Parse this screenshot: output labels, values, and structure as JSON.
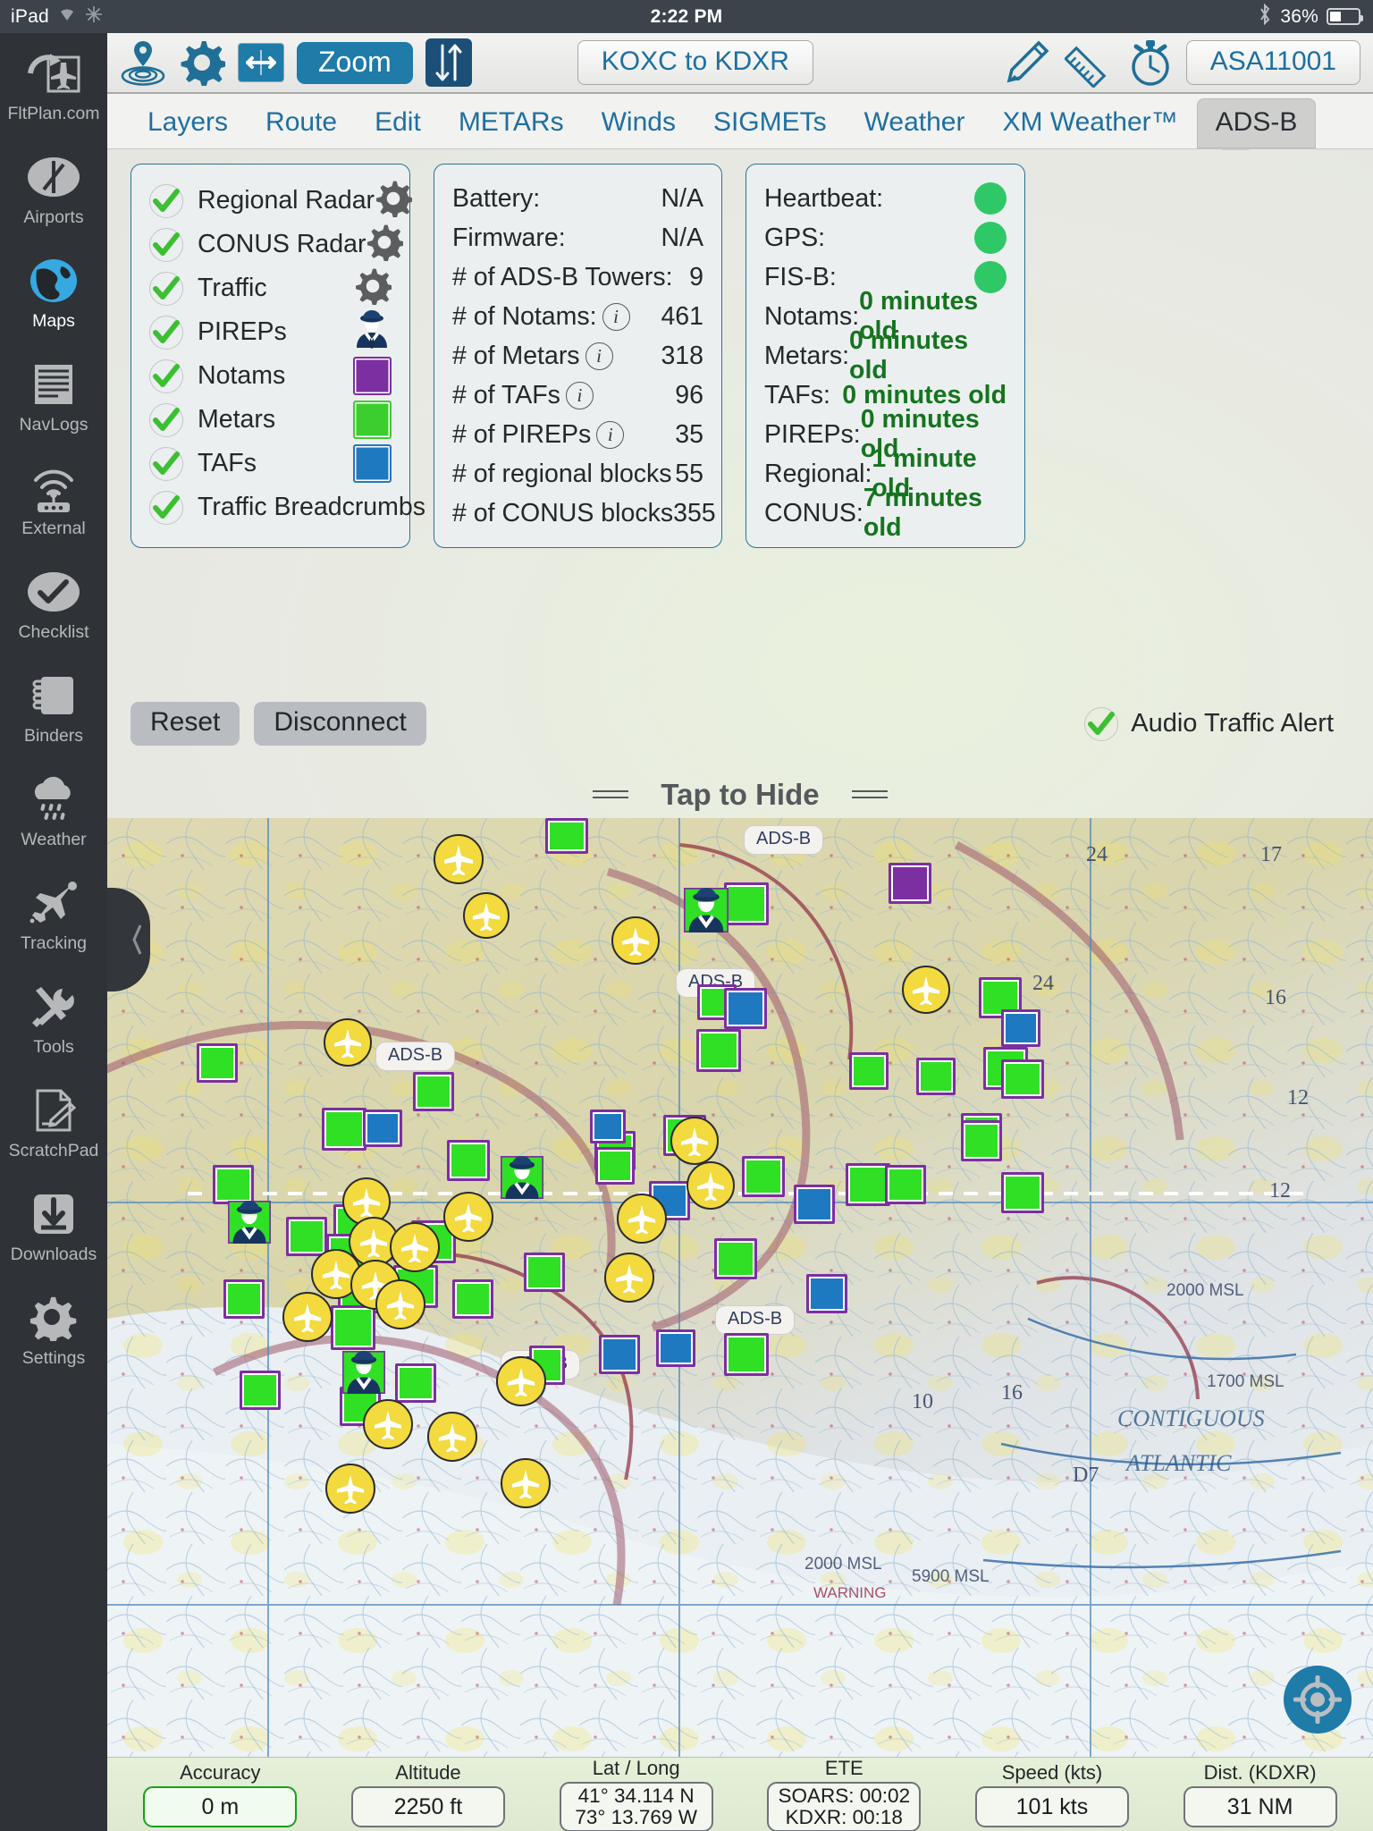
{
  "statusbar": {
    "device": "iPad",
    "wifi_icon": "wifi-icon",
    "sync_icon": "sync-icon",
    "time": "2:22 PM",
    "bluetooth_icon": "bluetooth-icon",
    "battery_pct": "36%"
  },
  "sidebar": {
    "items": [
      {
        "label": "FltPlan.com",
        "icon": "fltplan-logo-icon",
        "active": false
      },
      {
        "label": "Airports",
        "icon": "airports-icon",
        "active": false
      },
      {
        "label": "Maps",
        "icon": "globe-icon",
        "active": true
      },
      {
        "label": "NavLogs",
        "icon": "navlog-icon",
        "active": false
      },
      {
        "label": "External",
        "icon": "antenna-icon",
        "active": false
      },
      {
        "label": "Checklist",
        "icon": "checkmark-icon",
        "active": false
      },
      {
        "label": "Binders",
        "icon": "notebook-icon",
        "active": false
      },
      {
        "label": "Weather",
        "icon": "rain-cloud-icon",
        "active": false
      },
      {
        "label": "Tracking",
        "icon": "airplane-track-icon",
        "active": false
      },
      {
        "label": "Tools",
        "icon": "tools-icon",
        "active": false
      },
      {
        "label": "ScratchPad",
        "icon": "scratchpad-icon",
        "active": false
      },
      {
        "label": "Downloads",
        "icon": "download-icon",
        "active": false
      },
      {
        "label": "Settings",
        "icon": "gear-icon",
        "active": false
      }
    ]
  },
  "toolbar": {
    "icons": [
      {
        "name": "location-pin-icon"
      },
      {
        "name": "gear-icon"
      },
      {
        "name": "split-screen-icon"
      }
    ],
    "zoom_label": "Zoom",
    "updown_icon": "up-down-arrows-icon",
    "route_label": "KOXC to KDXR",
    "pencil_icon": "pencil-icon",
    "ruler_icon": "ruler-icon",
    "stopwatch_icon": "stopwatch-icon",
    "tail_number": "ASA11001"
  },
  "tabs": [
    {
      "label": "Layers",
      "active": false
    },
    {
      "label": "Route",
      "active": false
    },
    {
      "label": "Edit",
      "active": false
    },
    {
      "label": "METARs",
      "active": false
    },
    {
      "label": "Winds",
      "active": false
    },
    {
      "label": "SIGMETs",
      "active": false
    },
    {
      "label": "Weather",
      "active": false
    },
    {
      "label": "XM Weather™",
      "active": false
    },
    {
      "label": "ADS-B",
      "active": true
    }
  ],
  "layers_card": {
    "rows": [
      {
        "label": "Regional Radar",
        "checked": true,
        "control": "gear",
        "color": ""
      },
      {
        "label": "CONUS Radar",
        "checked": true,
        "control": "gear",
        "color": ""
      },
      {
        "label": "Traffic",
        "checked": true,
        "control": "gear",
        "color": ""
      },
      {
        "label": "PIREPs",
        "checked": true,
        "control": "pilot",
        "color": ""
      },
      {
        "label": "Notams",
        "checked": true,
        "control": "swatch",
        "color": "#7b2fa0"
      },
      {
        "label": "Metars",
        "checked": true,
        "control": "swatch",
        "color": "#3cce2e"
      },
      {
        "label": "TAFs",
        "checked": true,
        "control": "swatch",
        "color": "#1f79c0"
      },
      {
        "label": "Traffic Breadcrumbs",
        "checked": true,
        "control": "none",
        "color": ""
      }
    ]
  },
  "stats_card": {
    "rows": [
      {
        "label": "Battery:",
        "info": false,
        "value": "N/A"
      },
      {
        "label": "Firmware:",
        "info": false,
        "value": "N/A"
      },
      {
        "label": "# of ADS-B Towers:",
        "info": false,
        "value": "9"
      },
      {
        "label": "# of Notams:",
        "info": true,
        "value": "461"
      },
      {
        "label": "# of Metars",
        "info": true,
        "value": "318"
      },
      {
        "label": "# of TAFs",
        "info": true,
        "value": "96"
      },
      {
        "label": "# of PIREPs",
        "info": true,
        "value": "35"
      },
      {
        "label": "# of regional blocks",
        "info": false,
        "value": "55"
      },
      {
        "label": "# of CONUS blocks",
        "info": false,
        "value": "355"
      }
    ]
  },
  "status_card": {
    "rows": [
      {
        "label": "Heartbeat:",
        "type": "dot",
        "value": "",
        "color": "#2ec866"
      },
      {
        "label": "GPS:",
        "type": "dot",
        "value": "",
        "color": "#2ec866"
      },
      {
        "label": "FIS-B:",
        "type": "dot",
        "value": "",
        "color": "#2ec866"
      },
      {
        "label": "Notams:",
        "type": "text",
        "value": "0 minutes old",
        "color": "#15741f"
      },
      {
        "label": "Metars:",
        "type": "text",
        "value": "0 minutes old",
        "color": "#15741f"
      },
      {
        "label": "TAFs:",
        "type": "text",
        "value": "0 minutes old",
        "color": "#15741f"
      },
      {
        "label": "PIREPs:",
        "type": "text",
        "value": "0 minutes old",
        "color": "#15741f"
      },
      {
        "label": "Regional:",
        "type": "text",
        "value": "1 minute old",
        "color": "#15741f"
      },
      {
        "label": "CONUS:",
        "type": "text",
        "value": "7 minutes old",
        "color": "#15741f"
      }
    ]
  },
  "actions": {
    "reset_label": "Reset",
    "disconnect_label": "Disconnect",
    "audio_traffic_alert_label": "Audio Traffic Alert",
    "audio_traffic_alert_checked": true
  },
  "tap_to_hide": "Tap to Hide",
  "map": {
    "adsb_tower_labels": [
      "ADS-B",
      "ADS-B",
      "ADS-B",
      "ADS-B",
      "ADS-B"
    ],
    "chart_numbers": [
      "24",
      "17",
      "16",
      "12",
      "10",
      "D7",
      "2000 MSL",
      "1700 MSL",
      "5900 MSL",
      "WARNING"
    ],
    "ocean_labels": [
      "CONTIGUOUS",
      "ATLANTIC"
    ],
    "locate_icon": "crosshair-locate-icon"
  },
  "bottombar": {
    "cells": [
      {
        "label": "Accuracy",
        "lines": [
          "0 m"
        ],
        "accent": true
      },
      {
        "label": "Altitude",
        "lines": [
          "2250 ft"
        ],
        "accent": false
      },
      {
        "label": "Lat / Long",
        "lines": [
          "41° 34.114 N",
          "73° 13.769 W"
        ],
        "accent": false,
        "small": true
      },
      {
        "label": "ETE",
        "lines": [
          "SOARS: 00:02",
          "KDXR: 00:18"
        ],
        "accent": false,
        "small": true
      },
      {
        "label": "Speed (kts)",
        "lines": [
          "101 kts"
        ],
        "accent": false
      },
      {
        "label": "Dist. (KDXR)",
        "lines": [
          "31 NM"
        ],
        "accent": false
      }
    ]
  }
}
